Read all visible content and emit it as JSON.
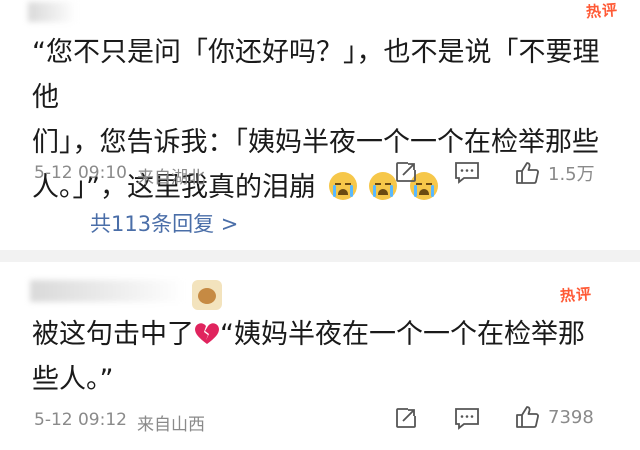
{
  "comments": [
    {
      "badge": "热评",
      "text_lines": [
        "“您不只是问「你还好吗？」，也不是说「不要理他",
        "们」，您告诉我：「姨妈半夜一个一个在检举那些",
        "人。」”，这里我真的泪崩"
      ],
      "emojis": [
        "crying-face",
        "crying-face",
        "crying-face"
      ],
      "time": "5-12 09:10",
      "location": "来自湖北",
      "like_count": "1.5万",
      "replies_label": "共113条回复 >"
    },
    {
      "badge": "热评",
      "text_lines": [
        "被这句击中了",
        "“姨妈半夜在一个一个在检举那",
        "些人。”"
      ],
      "emoji": "broken-heart",
      "time": "5-12 09:12",
      "location": "来自山西",
      "like_count": "7398"
    }
  ],
  "icons": [
    "share-icon",
    "comment-icon",
    "like-icon"
  ],
  "colors": {
    "hot_badge": "#ff5a36",
    "reply_link": "#4a6ea8",
    "meta": "#8a8a8a"
  }
}
